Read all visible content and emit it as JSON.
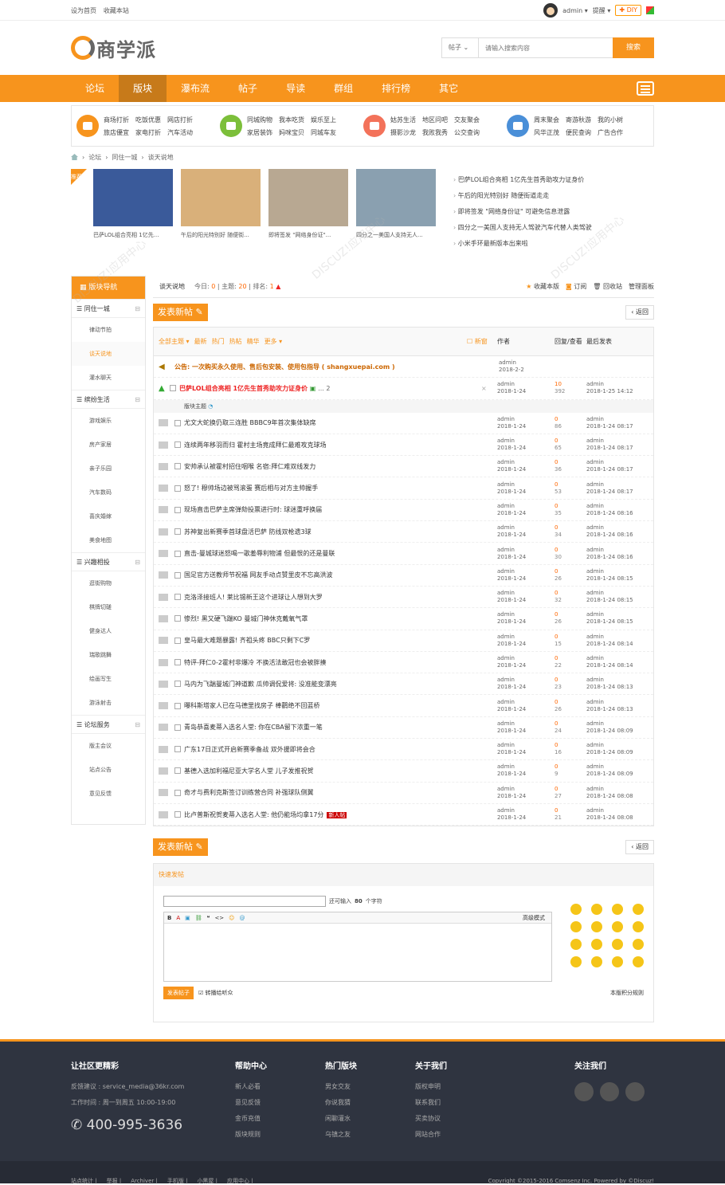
{
  "topbar": {
    "home": "设为首页",
    "fav": "收藏本站",
    "user": "admin",
    "remind": "提醒",
    "diy": "DIY"
  },
  "header": {
    "logo": "商学派",
    "search_type": "帖子",
    "search_placeholder": "请输入搜索内容",
    "search_btn": "搜索"
  },
  "nav": {
    "items": [
      "论坛",
      "版块",
      "瀑布流",
      "帖子",
      "导读",
      "群组",
      "排行榜",
      "其它"
    ]
  },
  "cats": [
    {
      "color": "#f7941d",
      "links": [
        "商场打折",
        "吃饭优惠",
        "网店打折",
        "旅店優宜",
        "家电打折",
        "汽车活动"
      ]
    },
    {
      "color": "#7cbf3a",
      "links": [
        "同城购物",
        "我本吃货",
        "娱乐至上",
        "家居装饰",
        "妈咪宝贝",
        "同城车友"
      ]
    },
    {
      "color": "#f3725a",
      "links": [
        "姑苏生活",
        "地区问吧",
        "交友聚会",
        "摄影沙龙",
        "我败我秀",
        "公交查询"
      ]
    },
    {
      "color": "#4a8fd8",
      "links": [
        "周末聚会",
        "寄游秋游",
        "我的小树",
        "风华正茂",
        "便民查询",
        "广告合作"
      ]
    }
  ],
  "crumb": [
    "论坛",
    "同住一城",
    "谈天说地"
  ],
  "slider": {
    "badge": "推荐",
    "pics": [
      {
        "cap": "巴萨LOL组合亮相 1亿先...",
        "color": "#3a5a9a"
      },
      {
        "cap": "午后的阳光特别好 随便街...",
        "color": "#d9b07a"
      },
      {
        "cap": "即将签发 \"网络身份证\"...",
        "color": "#b8a892"
      },
      {
        "cap": "四分之一美国人支持无人...",
        "color": "#8aa0b0"
      }
    ],
    "news": [
      "巴萨LOL组合亮相 1亿先生首秀助攻力证身价",
      "午后的阳光特别好 随便街道走走",
      "即将签发 \"网络身份证\" 可避免信息泄露",
      "四分之一美国人支持无人驾驶汽车代替人类驾驶",
      "小米手环最新版本出来啦"
    ]
  },
  "side": {
    "head": "版块导航",
    "groups": [
      {
        "name": "同住一城",
        "subs": [
          "律动节拍",
          "谈天说地",
          "灌水聊天"
        ]
      },
      {
        "name": "缤纷生活",
        "subs": [
          "游戏娱乐",
          "房产家居",
          "亲子乐园",
          "汽车数码",
          "喜庆婚嫁",
          "美食地图"
        ]
      },
      {
        "name": "兴趣相投",
        "subs": [
          "逛街购物",
          "棋牌切磋",
          "健身达人",
          "瑞歌跳舞",
          "绘画写生",
          "游泳射击"
        ]
      },
      {
        "name": "论坛服务",
        "subs": [
          "版主会议",
          "站点公告",
          "意见反馈"
        ]
      }
    ]
  },
  "forum": {
    "name": "谈天说地",
    "today_label": "今日:",
    "today": "0",
    "topics_label": "主题:",
    "topics": "20",
    "rank_label": "排名:",
    "rank": "1",
    "fav": "收藏本版",
    "sub": "订阅",
    "recycle": "回收站",
    "admin": "管理面板"
  },
  "post_btn": "发表新帖",
  "back": "返回",
  "thead": {
    "filters": [
      "全部主题",
      "最新",
      "热门",
      "热帖",
      "精华",
      "更多"
    ],
    "newwin": "新窗",
    "author": "作者",
    "reply": "回复/查看",
    "last": "最后发表"
  },
  "announce": {
    "title": "公告: 一次购买永久使用、售后包安装、使用包指导 ( shangxuepai.com )",
    "author": "admin",
    "date": "2018-2-2"
  },
  "sticky": {
    "title": "巴萨LOL组合亮相 1亿先生首秀助攻力证身价",
    "pages": "... 2",
    "author": "admin",
    "date": "2018-1-24",
    "replies": "10",
    "views": "392",
    "last_user": "admin",
    "last_date": "2018-1-25 14:12"
  },
  "sep": "版块主题",
  "threads": [
    {
      "t": "尤文大蛇换仍取三连胜 BBBC9年首次集体缺席",
      "r": "0",
      "v": "86",
      "ld": "2018-1-24 08:17"
    },
    {
      "t": "连续两年移羽而归 霍村主场竟成拜仁最难攻克球场",
      "r": "0",
      "v": "65",
      "ld": "2018-1-24 08:17"
    },
    {
      "t": "安帅承认被霍村招住咽喉 名宿:拜仁难双线发力",
      "r": "0",
      "v": "36",
      "ld": "2018-1-24 08:17"
    },
    {
      "t": "怒了! 穆帅场边被骂滚蛋 赛后相与对方主帅握手",
      "r": "0",
      "v": "53",
      "ld": "2018-1-24 08:17"
    },
    {
      "t": "现场直击巴萨主席弹劾投票进行时: 球迷重呼换届",
      "r": "0",
      "v": "35",
      "ld": "2018-1-24 08:16"
    },
    {
      "t": "苏神复出新赛季首球盘活巴萨 防线双枪遗3球",
      "r": "0",
      "v": "34",
      "ld": "2018-1-24 08:16"
    },
    {
      "t": "直击-曼城球迷怒喝一歌羞辱利物浦 但最恨的还是曼联",
      "r": "0",
      "v": "30",
      "ld": "2018-1-24 08:16"
    },
    {
      "t": "国足官方送教师节祝福 网友手动点赞里皮不忘高洪波",
      "r": "0",
      "v": "26",
      "ld": "2018-1-24 08:15"
    },
    {
      "t": "克洛泽接班人! 莱比锡新王这个进球让人想到大罗",
      "r": "0",
      "v": "32",
      "ld": "2018-1-24 08:15"
    },
    {
      "t": "惨烈! 黑又硬飞踹KO 曼城门神休克戴氧气罩",
      "r": "0",
      "v": "26",
      "ld": "2018-1-24 08:15"
    },
    {
      "t": "皇马最大难题暴露! 齐祖头疼 BBC只剩下C罗",
      "r": "0",
      "v": "15",
      "ld": "2018-1-24 08:14"
    },
    {
      "t": "特评-拜仁0-2霍村非爆冷 不换活法敢冠也会被胖揍",
      "r": "0",
      "v": "22",
      "ld": "2018-1-24 08:14"
    },
    {
      "t": "马内为飞踹曼城门神道歉 瓜帅调侃爱将: 没准能变漂亮",
      "r": "0",
      "v": "23",
      "ld": "2018-1-24 08:13"
    },
    {
      "t": "曝科斯塔家人已在马德里找房子 棒鹳绝不回蓝桥",
      "r": "0",
      "v": "26",
      "ld": "2018-1-24 08:13"
    },
    {
      "t": "青岛恭喜麦蒂入选名人堂: 你在CBA留下浓重一笔",
      "r": "0",
      "v": "24",
      "ld": "2018-1-24 08:09"
    },
    {
      "t": "广东17日正式开启新赛季备战 双外援即将会合",
      "r": "0",
      "v": "16",
      "ld": "2018-1-24 08:09"
    },
    {
      "t": "基德入选加利福尼亚大学名人堂 儿子发推祝贺",
      "r": "0",
      "v": "9",
      "ld": "2018-1-24 08:09"
    },
    {
      "t": "奇才与费利克斯签订训练营合同 补强球队侧翼",
      "r": "0",
      "v": "27",
      "ld": "2018-1-24 08:08"
    },
    {
      "t": "比卢普斯祝贺麦蒂入选名人堂: 他仍能场均拿17分",
      "r": "0",
      "v": "21",
      "ld": "2018-1-24 08:08",
      "new": "新人帖"
    }
  ],
  "thread_author": "admin",
  "thread_date": "2018-1-24",
  "thread_last_user": "admin",
  "quick": {
    "head": "快速发帖",
    "limit_pre": "还可输入",
    "limit": "80",
    "limit_post": "个字符",
    "adv": "高级模式",
    "submit": "发表帖子",
    "share": "转播给听众",
    "rule": "本版积分规则"
  },
  "footer": {
    "c1": {
      "h": "让社区更精彩",
      "p1": "反馈建议 : service_media@36kr.com",
      "p2": "工作时间 : 周一到周五 10:00-19:00",
      "phone": "400-995-3636"
    },
    "c2": {
      "h": "帮助中心",
      "items": [
        "新人必看",
        "意见反馈",
        "金币充值",
        "版块规则"
      ]
    },
    "c3": {
      "h": "热门版块",
      "items": [
        "男女交友",
        "你说我猜",
        "闲聊灌水",
        "乌镇之友"
      ]
    },
    "c4": {
      "h": "关于我们",
      "items": [
        "版权申明",
        "联系我们",
        "买卖协议",
        "网站合作"
      ]
    },
    "c5": {
      "h": "关注我们"
    },
    "links": [
      "站点统计",
      "举报",
      "Archiver",
      "手机版",
      "小黑屋",
      "应用中心"
    ],
    "copy": "Copyright ©2015-2016 Comsenz Inc. Powered by ©Discuz!"
  }
}
